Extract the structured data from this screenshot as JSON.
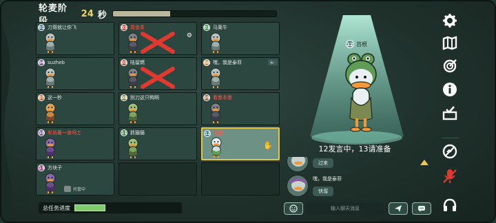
{
  "header": {
    "phase_label": "轮麦阶段",
    "seconds": "24",
    "seconds_unit": "秒",
    "timer_fraction": 0.35
  },
  "players": [
    {
      "num": "01",
      "name": "刀哥就让你飞",
      "num_color": "#3f6b8a",
      "red": false,
      "eliminated": false,
      "duck": "grey"
    },
    {
      "num": "02",
      "name": "晃金条",
      "num_color": "#c8402e",
      "red": true,
      "eliminated": true,
      "duck": "dark"
    },
    {
      "num": "03",
      "name": "马莱牛",
      "num_color": "#3a8a4a",
      "red": false,
      "eliminated": false,
      "duck": "grey"
    },
    {
      "num": "04",
      "name": "suzheb",
      "num_color": "#7a4a9a",
      "red": false,
      "eliminated": false,
      "duck": "grey"
    },
    {
      "num": "05",
      "name": "陆留燃",
      "num_color": "#c8402e",
      "red": false,
      "eliminated": true,
      "duck": "dark"
    },
    {
      "num": "06",
      "name": "嘿，我是泰菲",
      "num_color": "#d08a2e",
      "red": false,
      "eliminated": false,
      "duck": "grey"
    },
    {
      "num": "07",
      "name": "这一秒",
      "num_color": "#d06a2e",
      "red": false,
      "eliminated": false,
      "duck": "orange"
    },
    {
      "num": "08",
      "name": "别刀这只鸭啊",
      "num_color": "#7a7a3a",
      "red": false,
      "eliminated": false,
      "duck": "green"
    },
    {
      "num": "09",
      "name": "看墨本墨",
      "num_color": "#8a5a3a",
      "red": true,
      "eliminated": false,
      "duck": "dark"
    },
    {
      "num": "10",
      "name": "车站著一身吗士",
      "num_color": "#7a4a9a",
      "red": true,
      "eliminated": false,
      "duck": "purple"
    },
    {
      "num": "11",
      "name": "抓猫猫",
      "num_color": "#3a8a4a",
      "red": false,
      "eliminated": false,
      "duck": "green"
    },
    {
      "num": "12",
      "name": "苔根",
      "num_color": "#3f7a8a",
      "red": true,
      "eliminated": false,
      "duck": "white",
      "active": true
    },
    {
      "num": "13",
      "name": "方块子",
      "num_color": "#9a3a7a",
      "red": false,
      "eliminated": false,
      "duck": "purple",
      "status": "托管中"
    }
  ],
  "task": {
    "label": "总任务进度",
    "fraction": 0.3
  },
  "speaker": {
    "num": "12",
    "name": "苔根"
  },
  "speaking_status": "12发言中，13请准备",
  "chat": {
    "messages": [
      {
        "name": "",
        "text": "过来"
      },
      {
        "name": "嘿，我是泰菲",
        "text": "快溜"
      }
    ],
    "placeholder": "输入聊天消息"
  },
  "toolbar": [
    "gear-icon",
    "map-icon",
    "target-icon",
    "info-icon",
    "vote-box-icon",
    "no-vote-icon",
    "mic-off-icon",
    "headphone-icon"
  ],
  "colors": {
    "accent": "#e6c541",
    "danger": "#e0392f",
    "progress": "#7fcb6e"
  }
}
